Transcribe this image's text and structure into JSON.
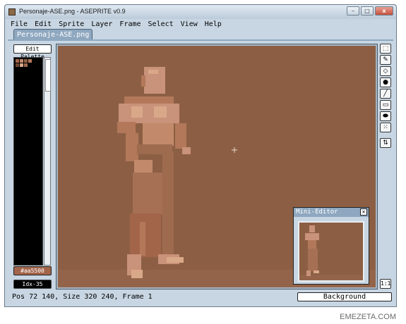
{
  "window": {
    "title": "Personaje-ASE.png - ASEPRITE v0.9",
    "minimize_glyph": "–",
    "maximize_glyph": "□",
    "close_glyph": "x"
  },
  "menu": [
    "File",
    "Edit",
    "Sprite",
    "Layer",
    "Frame",
    "Select",
    "View",
    "Help"
  ],
  "tab": {
    "label": "Personaje-ASE.png"
  },
  "palette": {
    "edit_label": "Edit Palette",
    "swatches": [
      "#a3654a",
      "#c28a6a",
      "#8c5f44",
      "#b3785a",
      "#6e4632",
      "#d9a888",
      "#9e6b4f"
    ],
    "current_color": "#aa5500",
    "current_color_label": "#aa5500",
    "index_label": "Idx-35"
  },
  "tools": {
    "items": [
      "marquee-icon",
      "pencil-icon",
      "eraser-icon",
      "bucket-icon",
      "line-icon",
      "rectangle-icon",
      "ellipse-icon",
      "spray-icon"
    ],
    "glyphs": [
      "⬚",
      "✎",
      "◇",
      "●",
      "╱",
      "▭",
      "⬬",
      "⁙"
    ],
    "config_glyph": "⇅",
    "zoom_label": "1:1"
  },
  "mini_editor": {
    "title": "Mini-Editor",
    "close_glyph": "✕"
  },
  "status": {
    "text": "Pos 72 140, Size 320 240, Frame 1",
    "layer": "Background"
  },
  "watermark": "EMEZETA.COM",
  "colors": {
    "canvas_bg": "#8c5f44",
    "figure_light": "#c9927a",
    "figure_mid": "#b3785a",
    "figure_dark": "#9e6b4f"
  }
}
